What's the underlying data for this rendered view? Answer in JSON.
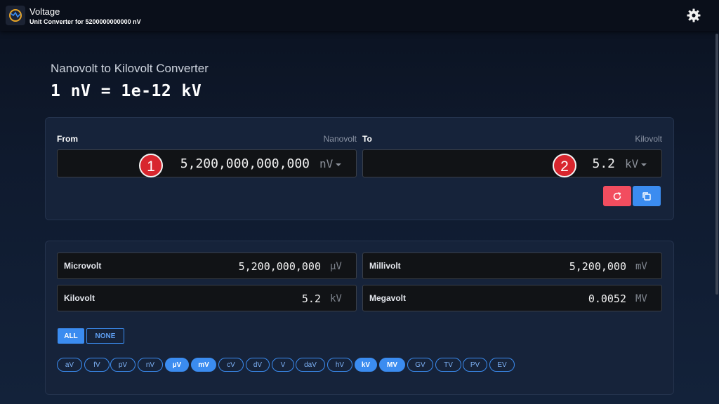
{
  "header": {
    "app_title": "Voltage",
    "app_subtitle": "Unit Converter for 5200000000000 nV"
  },
  "main": {
    "heading": "Nanovolt to Kilovolt Converter",
    "formula": "1 nV = 1e-12 kV"
  },
  "converter": {
    "from_label": "From",
    "from_unit_name": "Nanovolt",
    "from_value": "5,200,000,000,000",
    "from_unit": "nV",
    "to_label": "To",
    "to_unit_name": "Kilovolt",
    "to_value": "5.2",
    "to_unit": "kV",
    "badge_from": "1",
    "badge_to": "2"
  },
  "results": [
    {
      "name": "Microvolt",
      "value": "5,200,000,000",
      "unit": "µV"
    },
    {
      "name": "Millivolt",
      "value": "5,200,000",
      "unit": "mV"
    },
    {
      "name": "Kilovolt",
      "value": "5.2",
      "unit": "kV"
    },
    {
      "name": "Megavolt",
      "value": "0.0052",
      "unit": "MV"
    }
  ],
  "filter": {
    "all_label": "ALL",
    "none_label": "NONE",
    "chips": [
      {
        "label": "aV",
        "on": false
      },
      {
        "label": "fV",
        "on": false
      },
      {
        "label": "pV",
        "on": false
      },
      {
        "label": "nV",
        "on": false
      },
      {
        "label": "µV",
        "on": true
      },
      {
        "label": "mV",
        "on": true
      },
      {
        "label": "cV",
        "on": false
      },
      {
        "label": "dV",
        "on": false
      },
      {
        "label": "V",
        "on": false
      },
      {
        "label": "daV",
        "on": false
      },
      {
        "label": "hV",
        "on": false
      },
      {
        "label": "kV",
        "on": true
      },
      {
        "label": "MV",
        "on": true
      },
      {
        "label": "GV",
        "on": false
      },
      {
        "label": "TV",
        "on": false
      },
      {
        "label": "PV",
        "on": false
      },
      {
        "label": "EV",
        "on": false
      }
    ]
  },
  "colors": {
    "accent": "#3b8cf0",
    "reset": "#f24d5f",
    "badge": "#d8262e"
  }
}
